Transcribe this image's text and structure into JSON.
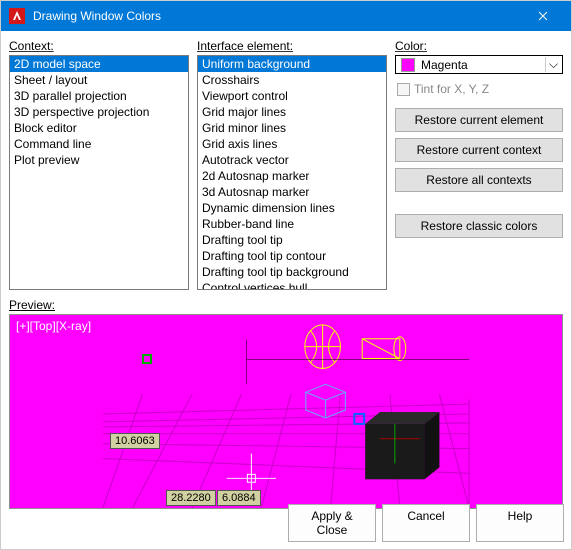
{
  "title": "Drawing Window Colors",
  "labels": {
    "context": "Context:",
    "interface": "Interface element:",
    "color": "Color:",
    "tint": "Tint for X, Y, Z",
    "preview": "Preview:"
  },
  "context_items": [
    "2D model space",
    "Sheet / layout",
    "3D parallel projection",
    "3D perspective projection",
    "Block editor",
    "Command line",
    "Plot preview"
  ],
  "interface_items": [
    "Uniform background",
    "Crosshairs",
    "Viewport control",
    "Grid major lines",
    "Grid minor lines",
    "Grid axis lines",
    "Autotrack vector",
    "2d Autosnap marker",
    "3d Autosnap marker",
    "Dynamic dimension lines",
    "Rubber-band line",
    "Drafting tool tip",
    "Drafting tool tip contour",
    "Drafting tool tip background",
    "Control vertices hull"
  ],
  "selected_color": "Magenta",
  "buttons": {
    "restore_element": "Restore current element",
    "restore_context": "Restore current context",
    "restore_all": "Restore all contexts",
    "restore_classic": "Restore classic colors",
    "apply": "Apply & Close",
    "cancel": "Cancel",
    "help": "Help"
  },
  "preview": {
    "view_label": "[+][Top][X-ray]",
    "coords": {
      "c1": "10.6063",
      "c2": "28.2280",
      "c3": "6.0884"
    }
  }
}
